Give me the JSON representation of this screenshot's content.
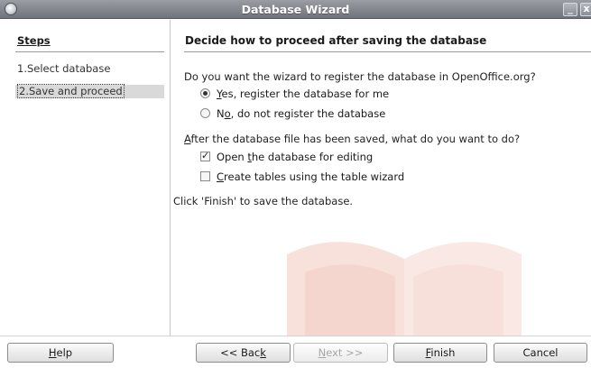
{
  "window": {
    "title": "Database Wizard",
    "minimize_glyph": "_",
    "close_glyph": "x"
  },
  "steps": {
    "heading": "Steps",
    "items": [
      {
        "label": "1.Select database",
        "active": false
      },
      {
        "label": "2.Save and proceed",
        "active": true
      }
    ]
  },
  "content": {
    "heading": "Decide how to proceed after saving the database",
    "register_question": "Do you want the wizard to register the database in OpenOffice.org?",
    "register_options": [
      {
        "mn": "Y",
        "rest": "es, register the database for me",
        "selected": true
      },
      {
        "pre": "N",
        "mn": "o",
        "rest": ", do not register the database",
        "selected": false
      }
    ],
    "after_question_mn": "A",
    "after_question_rest": "fter the database file has been saved, what do you want to do?",
    "after_options": [
      {
        "pre": "Open ",
        "mn": "t",
        "rest": "he database for editing",
        "checked": true
      },
      {
        "pre": "",
        "mn": "C",
        "rest": "reate tables using the table wizard",
        "checked": false
      }
    ],
    "finish_note": "Click 'Finish' to save the database."
  },
  "buttons": {
    "help": {
      "mn": "H",
      "rest": "elp"
    },
    "back": {
      "pre": "<< Bac",
      "mn": "k",
      "rest": ""
    },
    "next": {
      "mn": "N",
      "rest": "ext >>",
      "enabled": false
    },
    "finish": {
      "mn": "F",
      "rest": "inish"
    },
    "cancel": "Cancel"
  },
  "colors": {
    "titlebar": "#7f838a",
    "selected_step_bg": "#d9d9d9",
    "watermark": "#d98a7a"
  }
}
